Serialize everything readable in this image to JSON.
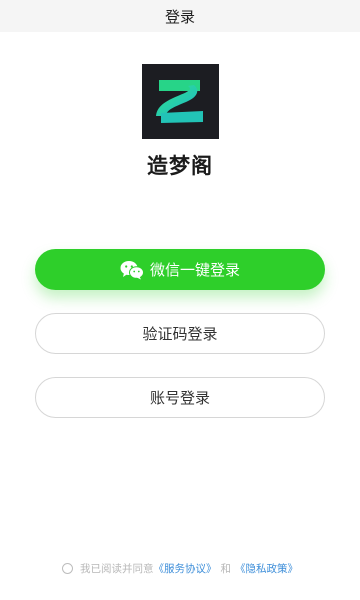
{
  "header": {
    "title": "登录"
  },
  "app": {
    "name": "造梦阁",
    "logo_icon": "app-logo-z-icon"
  },
  "buttons": {
    "wechat_login": "微信一键登录",
    "code_login": "验证码登录",
    "account_login": "账号登录"
  },
  "agreement": {
    "prefix": "我已阅读并同意",
    "service_link": "《服务协议》",
    "conjunction": "和",
    "privacy_link": "《隐私政策》"
  },
  "colors": {
    "wechat_green": "#2ecf2a",
    "link_blue": "#3d8ed9",
    "logo_bg": "#1c1d22"
  }
}
